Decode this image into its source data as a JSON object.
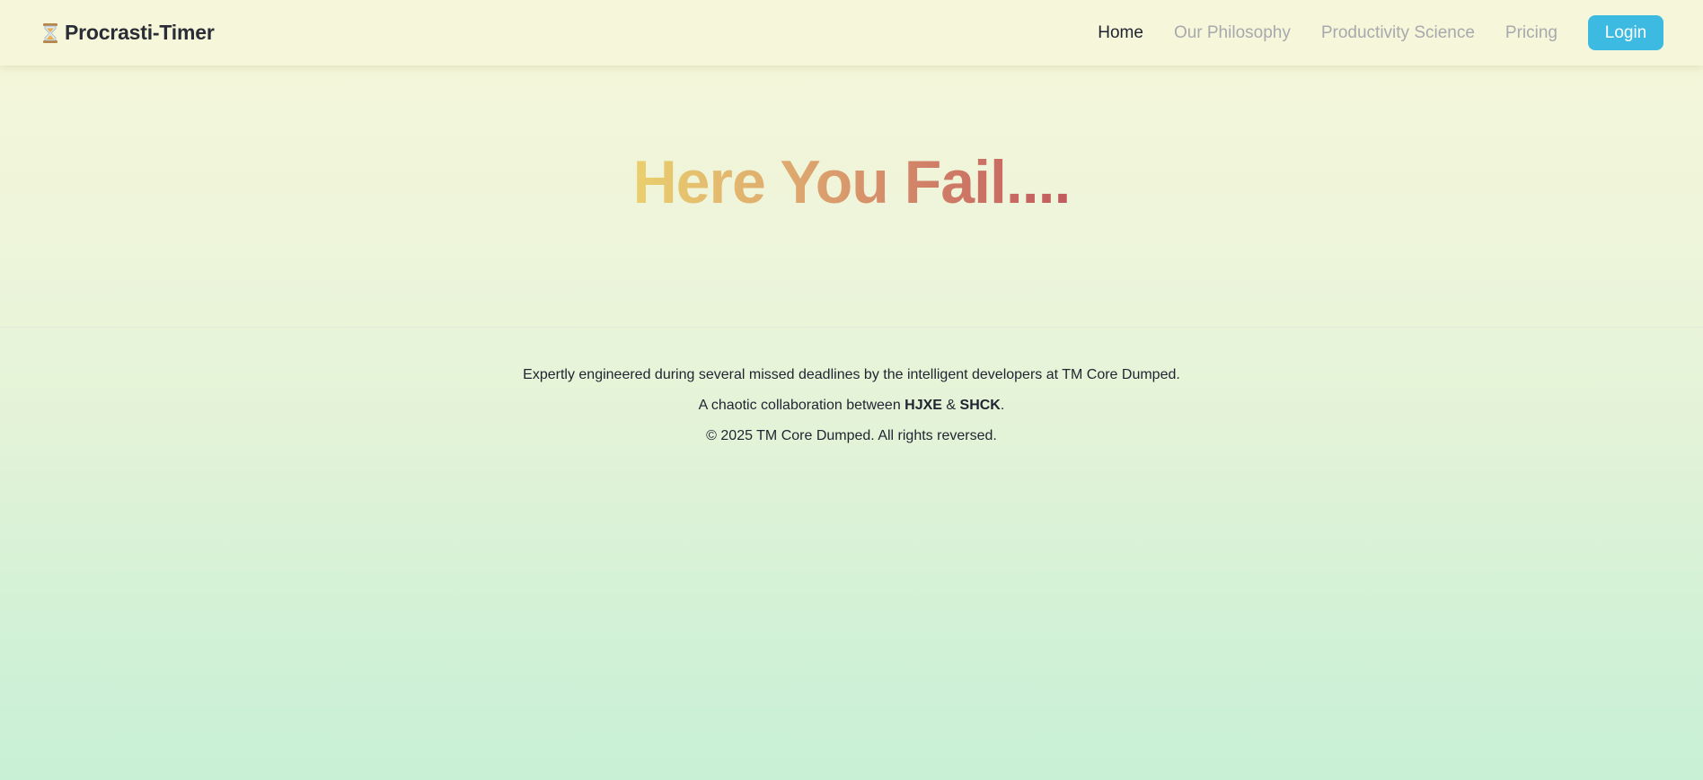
{
  "brand": {
    "icon": "hourglass-icon",
    "name": "Procrasti-Timer"
  },
  "nav": {
    "links": [
      {
        "label": "Home",
        "active": true
      },
      {
        "label": "Our Philosophy",
        "active": false
      },
      {
        "label": "Productivity Science",
        "active": false
      },
      {
        "label": "Pricing",
        "active": false
      }
    ],
    "login_label": "Login"
  },
  "hero": {
    "title": "Here You Fail...."
  },
  "footer": {
    "line1": "Expertly engineered during several missed deadlines by the intelligent developers at TM Core Dumped.",
    "line2_prefix": "A chaotic collaboration between ",
    "line2_name1": "HJXE",
    "line2_sep": " & ",
    "line2_name2": "SHCK",
    "line2_suffix": ".",
    "line3": "© 2025 TM Core Dumped. All rights reversed."
  },
  "colors": {
    "login_button": "#3dbae2",
    "title_gradient_start": "#ead06e",
    "title_gradient_end": "#c25a5c",
    "nav_active": "#1f2430",
    "nav_inactive": "#a7a9ad"
  }
}
